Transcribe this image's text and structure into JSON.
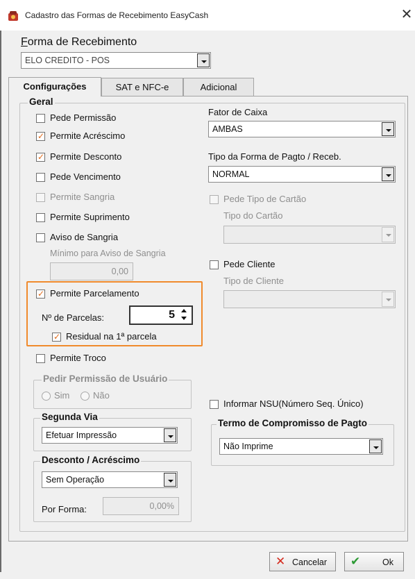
{
  "window": {
    "title": "Cadastro das Formas de Recebimento EasyCash",
    "close_glyph": "✕"
  },
  "forma": {
    "label": "Forma de Recebimento",
    "value": "ELO CREDITO - POS"
  },
  "tabs": [
    {
      "label": "Configurações",
      "active": true
    },
    {
      "label": "SAT e NFC-e",
      "active": false
    },
    {
      "label": "Adicional",
      "active": false
    }
  ],
  "geral": {
    "legend": "Geral",
    "checks": {
      "pede_permissao": {
        "label": "Pede Permissão",
        "checked": false,
        "enabled": true
      },
      "permite_acrescimo": {
        "label": "Permite Acréscimo",
        "checked": true,
        "enabled": true
      },
      "permite_desconto": {
        "label": "Permite Desconto",
        "checked": true,
        "enabled": true
      },
      "pede_vencimento": {
        "label": "Pede Vencimento",
        "checked": false,
        "enabled": true
      },
      "permite_sangria": {
        "label": "Permite Sangria",
        "checked": false,
        "enabled": false
      },
      "permite_suprimento": {
        "label": "Permite Suprimento",
        "checked": false,
        "enabled": true
      },
      "aviso_sangria": {
        "label": "Aviso de Sangria",
        "checked": false,
        "enabled": true
      },
      "permite_parcelamento": {
        "label": "Permite Parcelamento",
        "checked": true,
        "enabled": true
      },
      "residual": {
        "label": "Residual na 1ª parcela",
        "checked": true,
        "enabled": true
      },
      "permite_troco": {
        "label": "Permite Troco",
        "checked": false,
        "enabled": true
      },
      "pede_tipo_cartao": {
        "label": "Pede Tipo de Cartão",
        "checked": false,
        "enabled": false
      },
      "pede_cliente": {
        "label": "Pede Cliente",
        "checked": false,
        "enabled": true
      },
      "informar_nsu": {
        "label": "Informar NSU(Número Seq. Único)",
        "checked": false,
        "enabled": true
      }
    },
    "minimo_aviso": {
      "label": "Mínimo para Aviso de Sangria",
      "value": "0,00"
    },
    "parcelas": {
      "label": "Nº de Parcelas:",
      "value": "5"
    },
    "fator_caixa": {
      "label": "Fator de Caixa",
      "value": "AMBAS"
    },
    "tipo_forma": {
      "label": "Tipo da Forma de Pagto / Receb.",
      "value": "NORMAL"
    },
    "tipo_cartao": {
      "label": "Tipo do Cartão",
      "value": ""
    },
    "tipo_cliente": {
      "label": "Tipo de Cliente",
      "value": ""
    }
  },
  "pedir_permissao": {
    "legend": "Pedir Permissão de Usuário",
    "options": [
      "Sim",
      "Não"
    ]
  },
  "segunda_via": {
    "legend": "Segunda Via",
    "value": "Efetuar Impressão"
  },
  "desconto_acrescimo": {
    "legend": "Desconto / Acréscimo",
    "value": "Sem Operação",
    "por_forma_label": "Por Forma:",
    "por_forma_value": "0,00%"
  },
  "termo": {
    "legend": "Termo de Compromisso de Pagto",
    "value": "Não Imprime"
  },
  "footer": {
    "cancel_label": "Cancelar",
    "ok_label": "Ok"
  },
  "colors": {
    "check_mark": "#e06a1b",
    "highlight_border": "#f08a2c",
    "cancel_icon": "#d42a1e",
    "ok_icon": "#2c9a34"
  }
}
